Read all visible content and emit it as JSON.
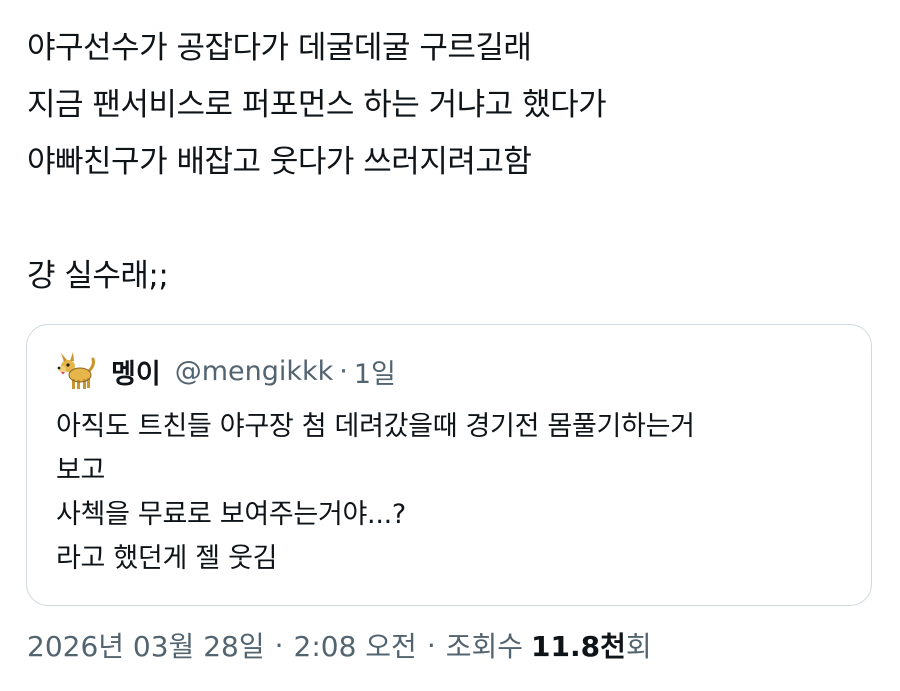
{
  "tweet": {
    "lines": [
      "야구선수가 공잡다가 데굴데굴 구르길래",
      "지금 팬서비스로 퍼포먼스 하는 거냐고 했다가",
      "야빠친구가 배잡고 웃다가 쓰러지려고함",
      "",
      "걍 실수래;;"
    ]
  },
  "quote": {
    "avatar": "dog-avatar-icon",
    "display_name": "멩이",
    "handle": "@mengikkk",
    "separator": "·",
    "time": "1일",
    "lines": [
      "아직도 트친들 야구장 첨 데려갔을때 경기전 몸풀기하는거",
      "보고",
      "사첵을 무료로 보여주는거야...?",
      "라고 했던게 젤 웃김"
    ]
  },
  "meta": {
    "date": "2026년 03월 28일",
    "separator": "·",
    "time": "2:08 오전",
    "views_label_prefix": "조회수",
    "views_count": "11.8천",
    "views_label_suffix": "회"
  },
  "colors": {
    "text": "#0f1419",
    "secondary": "#536471",
    "border": "#cfd9de"
  }
}
